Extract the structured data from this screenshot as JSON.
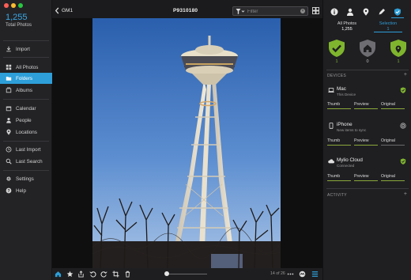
{
  "sidebar": {
    "total_count": "1,255",
    "total_label": "Total Photos",
    "items": [
      {
        "label": "Import",
        "icon": "import-icon"
      },
      {
        "label": "All Photos",
        "icon": "grid-icon"
      },
      {
        "label": "Folders",
        "icon": "folder-icon",
        "active": true
      },
      {
        "label": "Albums",
        "icon": "albums-icon"
      },
      {
        "label": "Calendar",
        "icon": "calendar-icon"
      },
      {
        "label": "People",
        "icon": "person-icon"
      },
      {
        "label": "Locations",
        "icon": "pin-icon"
      },
      {
        "label": "Last Import",
        "icon": "history-icon"
      },
      {
        "label": "Last Search",
        "icon": "search-icon"
      },
      {
        "label": "Settings",
        "icon": "gear-icon"
      },
      {
        "label": "Help",
        "icon": "help-icon"
      }
    ]
  },
  "toolbar": {
    "breadcrumb": "GM1",
    "title": "P9310180",
    "filter_placeholder": "Filter"
  },
  "viewer": {
    "page_indicator": "14 of 26"
  },
  "right_panel": {
    "stats": {
      "all_label": "All Photos",
      "all_count": "1,255",
      "selection_label": "Selection",
      "selection_count": "1"
    },
    "shields": [
      {
        "icon": "check-shield-icon",
        "count": "1",
        "color": "#7fb52e"
      },
      {
        "icon": "home-shield-icon",
        "count": "0",
        "color": "#6e6e72"
      },
      {
        "icon": "pin-shield-icon",
        "count": "1",
        "color": "#7fb52e"
      }
    ],
    "devices_header": "DEVICES",
    "devices": [
      {
        "name": "Mac",
        "subtitle": "This Device",
        "buttons": [
          "Thumb",
          "Preview",
          "Original"
        ]
      },
      {
        "name": "iPhone",
        "subtitle": "New items to sync",
        "buttons": [
          "Thumb",
          "Preview",
          "Original"
        ]
      },
      {
        "name": "Mylio Cloud",
        "subtitle": "Connected",
        "buttons": [
          "Thumb",
          "Preview",
          "Original"
        ]
      }
    ],
    "activity_header": "ACTIVITY"
  },
  "colors": {
    "accent": "#2e9fd8",
    "green": "#7fb52e"
  }
}
